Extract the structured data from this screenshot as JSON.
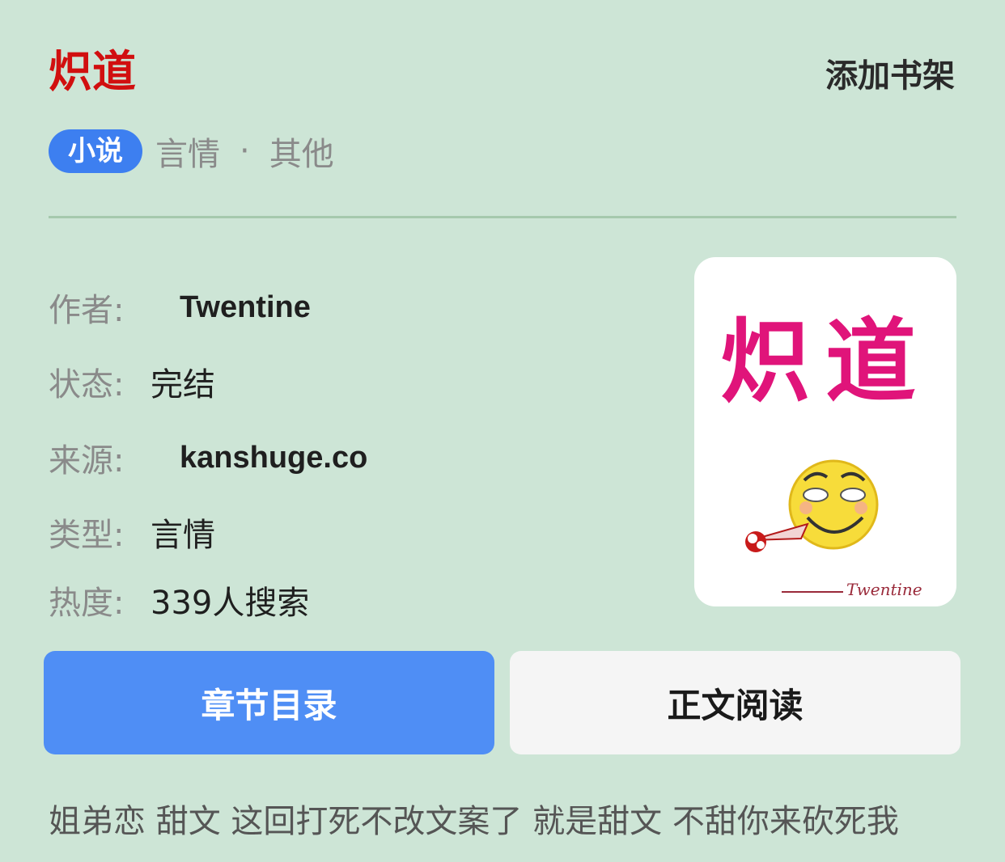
{
  "book": {
    "title": "炽道",
    "category_badge": "小说",
    "genre": "言情",
    "genre_separator": "·",
    "subgenre": "其他"
  },
  "header": {
    "add_to_shelf_label": "添加书架"
  },
  "info": {
    "author_label": "作者:",
    "author_value": "Twentine",
    "status_label": "状态:",
    "status_value": "完结",
    "source_label": "来源:",
    "source_value": "kanshuge.co",
    "type_label": "类型:",
    "type_value": "言情",
    "popularity_label": "热度:",
    "popularity_value": "339人搜索"
  },
  "cover": {
    "title_text": "炽道",
    "signature_text": "Twentine",
    "title_color": "#e0147a"
  },
  "actions": {
    "toc_label": "章节目录",
    "read_label": "正文阅读"
  },
  "description": "姐弟恋 甜文 这回打死不改文案了 就是甜文 不甜你来砍死我",
  "colors": {
    "background": "#cde5d6",
    "title_red": "#d10f0f",
    "accent_blue": "#4f8ef5",
    "badge_blue": "#3d7ff0"
  }
}
